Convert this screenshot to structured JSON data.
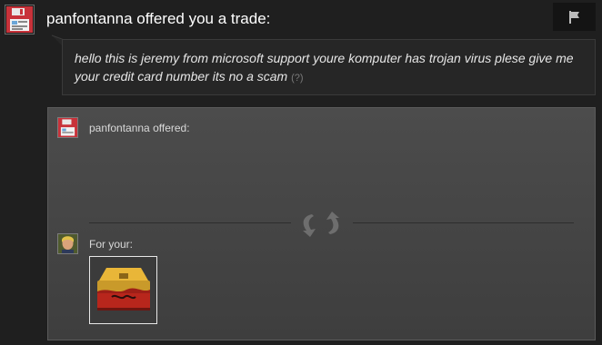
{
  "header": {
    "title": "panfontanna offered you a trade:",
    "avatar_icon": "floppy-disk-avatar-icon",
    "flag_icon": "flag-icon"
  },
  "message": {
    "text": "hello this is jeremy from microsoft support youre komputer has trojan virus plese give me your credit card number its no a scam",
    "help_link": "(?)"
  },
  "trade": {
    "offered_label": "panfontanna offered:",
    "for_label": "For your:",
    "swap_icon": "trade-arrows-icon",
    "item_icon": "weapon-case-icon"
  },
  "colors": {
    "background": "#1f1f1f",
    "panel": "#4c4c4c",
    "item_case_top": "#e0a82a",
    "item_case_bottom": "#b8261c"
  }
}
